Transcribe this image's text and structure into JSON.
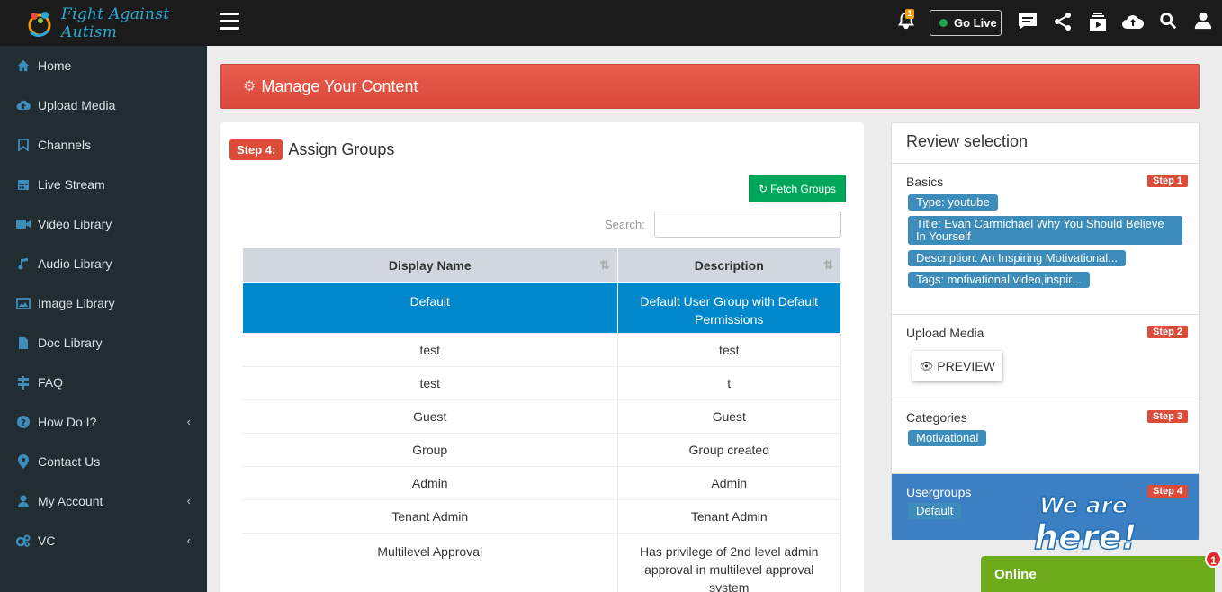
{
  "header": {
    "logo_text": "Fight Against Autism",
    "notification_count": "1",
    "go_live_label": "Go Live"
  },
  "sidebar": {
    "items": [
      {
        "label": "Home",
        "icon": "home-icon"
      },
      {
        "label": "Upload Media",
        "icon": "cloud-upload-icon"
      },
      {
        "label": "Channels",
        "icon": "bookmark-icon"
      },
      {
        "label": "Live Stream",
        "icon": "calendar-icon"
      },
      {
        "label": "Video Library",
        "icon": "video-camera-icon"
      },
      {
        "label": "Audio Library",
        "icon": "music-icon"
      },
      {
        "label": "Image Library",
        "icon": "image-icon"
      },
      {
        "label": "Doc Library",
        "icon": "document-icon"
      },
      {
        "label": "FAQ",
        "icon": "signpost-icon"
      },
      {
        "label": "How Do I?",
        "icon": "question-icon"
      },
      {
        "label": "Contact Us",
        "icon": "map-marker-icon"
      },
      {
        "label": "My Account",
        "icon": "user-icon"
      },
      {
        "label": "VC",
        "icon": "cogs-icon"
      }
    ]
  },
  "banner": {
    "title": "Manage Your Content"
  },
  "assign": {
    "step_badge": "Step 4:",
    "title": "Assign Groups",
    "fetch_button": "Fetch Groups",
    "search_label": "Search:",
    "search_value": "",
    "columns": [
      "Display Name",
      "Description"
    ],
    "rows": [
      {
        "name": "Default",
        "description": "Default User Group with Default Permissions"
      },
      {
        "name": "test",
        "description": "test"
      },
      {
        "name": "test",
        "description": "t"
      },
      {
        "name": "Guest",
        "description": "Guest"
      },
      {
        "name": "Group",
        "description": "Group created"
      },
      {
        "name": "Admin",
        "description": "Admin"
      },
      {
        "name": "Tenant Admin",
        "description": "Tenant Admin"
      },
      {
        "name": "Multilevel Approval",
        "description": "Has privilege of 2nd level admin approval in multilevel approval system"
      }
    ]
  },
  "review": {
    "title": "Review selection",
    "basics_label": "Basics",
    "basics_step": "Step 1",
    "type": "Type: youtube",
    "title_value": "Title: Evan Carmichael Why You Should Believe In Yourself",
    "description": "Description: An Inspiring Motivational...",
    "tags": "Tags: motivational video,inspir...",
    "upload_label": "Upload Media",
    "upload_step": "Step 2",
    "preview_label": "PREVIEW",
    "categories_label": "Categories",
    "categories_step": "Step 3",
    "category": "Motivational",
    "usergroups_label": "Usergroups",
    "usergroups_step": "Step 4",
    "usergroup": "Default"
  },
  "widget": {
    "we_are_here": "We are here!",
    "online_label": "Online",
    "online_badge": "1"
  },
  "colors": {
    "sidebar_bg": "#222d32",
    "banner": "#dd4b39",
    "selected_row": "#0088cc",
    "pill": "#3c8dbc",
    "fetch": "#00a65a",
    "online": "#6dab1d"
  }
}
